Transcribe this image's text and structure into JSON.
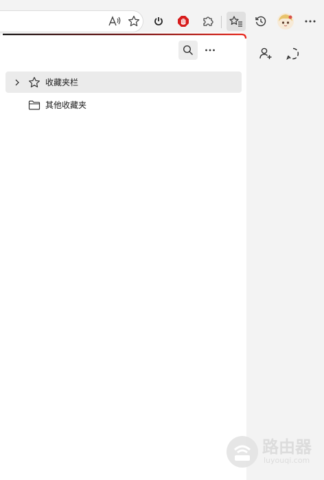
{
  "toolbar": {
    "icons": [
      "read-aloud-icon",
      "add-favorite-icon",
      "power-icon",
      "adblock-icon",
      "extensions-icon",
      "favorites-icon",
      "history-icon",
      "profile-avatar",
      "more-icon"
    ]
  },
  "panel": {
    "actions": [
      "search-icon",
      "more-options-icon"
    ],
    "items": [
      {
        "label": "收藏夹栏",
        "icon": "star-icon",
        "expandable": true
      },
      {
        "label": "其他收藏夹",
        "icon": "folder-icon",
        "expandable": false
      }
    ]
  },
  "sidebar": {
    "icons": [
      "add-user-icon",
      "lasso-icon"
    ]
  },
  "watermark": {
    "title": "路由器",
    "subtitle": "luyouqi.com"
  },
  "colors": {
    "adblock_red": "#d71c1c",
    "edge_gradient_start": "#111111",
    "edge_gradient_mid": "#e8251b",
    "edge_gradient_end": "#f2ea00"
  }
}
